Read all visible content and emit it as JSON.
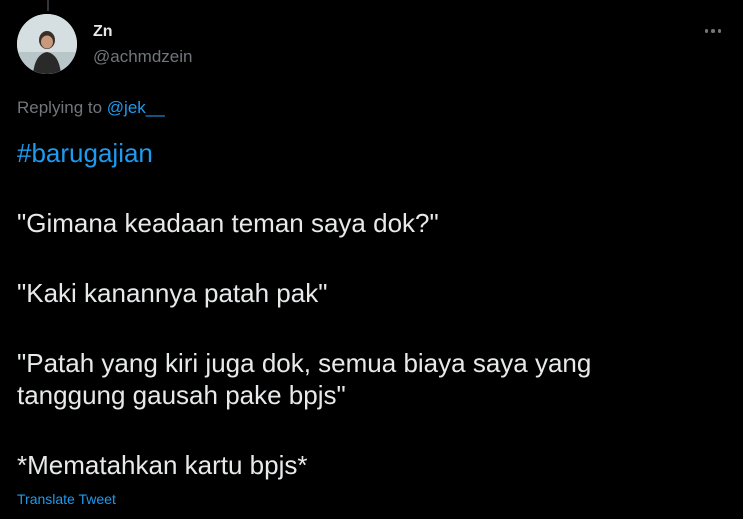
{
  "user": {
    "display_name": "Zn",
    "handle": "@achmdzein",
    "avatar_icon": "profile-photo"
  },
  "replying": {
    "prefix": "Replying to ",
    "mention": "@jek__"
  },
  "tweet": {
    "hashtag": "#barugajian",
    "lines": [
      "\"Gimana keadaan teman saya dok?\"",
      "\"Kaki kanannya patah pak\"",
      "\"Patah yang kiri juga dok, semua biaya saya yang tanggung gausah pake bpjs\"",
      "*Mematahkan kartu bpjs*"
    ]
  },
  "actions": {
    "translate_label": "Translate Tweet",
    "more_icon": "more-horizontal-icon"
  },
  "colors": {
    "background": "#000000",
    "text": "#e7e9ea",
    "secondary": "#71767b",
    "link": "#1d9bf0"
  }
}
